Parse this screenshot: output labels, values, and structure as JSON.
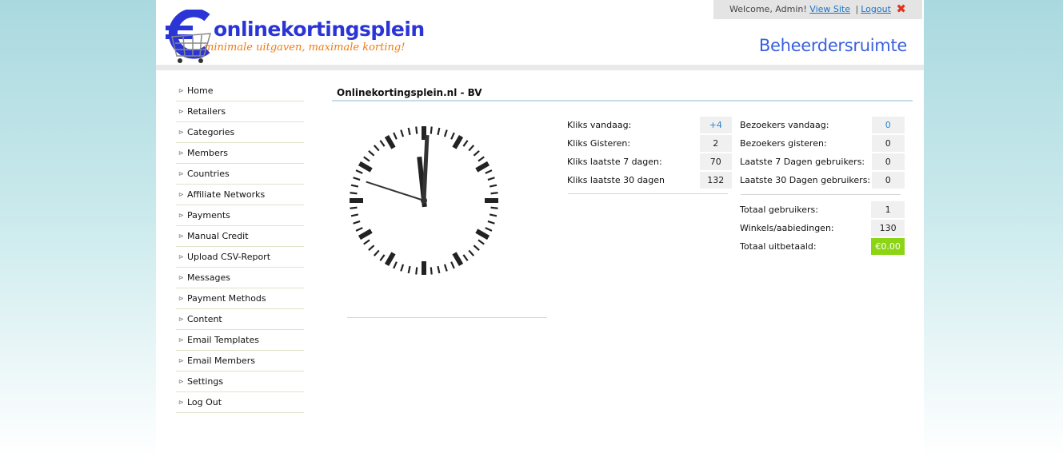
{
  "header": {
    "logo_title": "onlinekortingsplein",
    "logo_tagline": "minimale uitgaven, maximale korting!",
    "welcome_text": "Welcome, Admin!",
    "view_site_label": "View Site",
    "separator": "|",
    "logout_label": "Logout",
    "area_title": "Beheerdersruimte"
  },
  "sidebar": {
    "items": [
      {
        "label": "Home"
      },
      {
        "label": "Retailers"
      },
      {
        "label": "Categories"
      },
      {
        "label": "Members"
      },
      {
        "label": "Countries"
      },
      {
        "label": "Affiliate Networks"
      },
      {
        "label": "Payments"
      },
      {
        "label": "Manual Credit"
      },
      {
        "label": "Upload CSV-Report"
      },
      {
        "label": "Messages"
      },
      {
        "label": "Payment Methods"
      },
      {
        "label": "Content"
      },
      {
        "label": "Email Templates"
      },
      {
        "label": "Email Members"
      },
      {
        "label": "Settings"
      },
      {
        "label": "Log Out"
      }
    ]
  },
  "main": {
    "title": "Onlinekortingsplein.nl - BV",
    "clock": {
      "hour": 12,
      "minute": 2,
      "second": 48
    },
    "clicks": [
      {
        "label": "Kliks vandaag:",
        "value": "+4"
      },
      {
        "label": "Kliks Gisteren:",
        "value": "2"
      },
      {
        "label": "Kliks laatste 7 dagen:",
        "value": "70"
      },
      {
        "label": "Kliks laatste 30 dagen",
        "value": "132"
      }
    ],
    "visitors": [
      {
        "label": "Bezoekers vandaag:",
        "value": "0"
      },
      {
        "label": "Bezoekers gisteren:",
        "value": "0"
      },
      {
        "label": "Laatste 7 Dagen gebruikers:",
        "value": "0"
      },
      {
        "label": "Laatste 30 Dagen gebruikers:",
        "value": "0"
      }
    ],
    "totals": [
      {
        "label": "Totaal gebruikers:",
        "value": "1"
      },
      {
        "label": "Winkels/aabiedingen:",
        "value": "130"
      },
      {
        "label": "Totaal uitbetaald:",
        "value": "€0.00"
      }
    ]
  },
  "colors": {
    "brand_blue": "#2b35d6",
    "brand_orange": "#f07b12",
    "accent_green": "#8bd515",
    "link_blue": "#1a73c8"
  },
  "icons": [
    "euro-cart-logo-icon",
    "logout-x-icon",
    "menu-arrow-icon",
    "analog-clock"
  ]
}
